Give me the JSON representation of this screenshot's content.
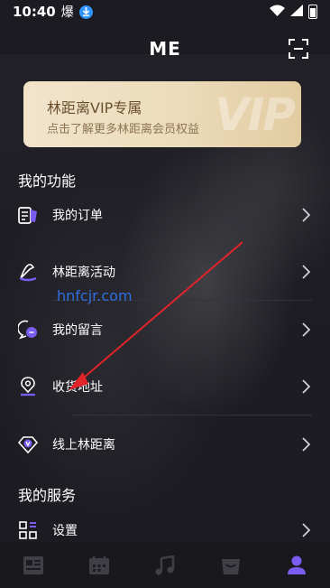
{
  "status_bar": {
    "time": "10:40",
    "boom_glyph": "爆"
  },
  "header": {
    "title": "ME"
  },
  "vip": {
    "title": "林距离VIP专属",
    "subtitle": "点击了解更多林距离会员权益",
    "watermark": "VIP"
  },
  "sections": {
    "functions_title": "我的功能",
    "services_title": "我的服务"
  },
  "menu": [
    {
      "label": "我的订单",
      "icon": "order-icon"
    },
    {
      "label": "林距离活动",
      "icon": "wizard-hat-icon"
    },
    {
      "label": "我的留言",
      "icon": "message-icon"
    },
    {
      "label": "收货地址",
      "icon": "location-icon"
    },
    {
      "label": "线上林距离",
      "icon": "diamond-v-icon"
    },
    {
      "label": "设置",
      "icon": "settings-grid-icon"
    }
  ],
  "watermark_link": "hnfcjr.com",
  "tabs": [
    {
      "name": "news-tab",
      "icon": "newspaper-icon",
      "active": false
    },
    {
      "name": "calendar-tab",
      "icon": "calendar-icon",
      "active": false
    },
    {
      "name": "music-tab",
      "icon": "music-note-icon",
      "active": false
    },
    {
      "name": "shop-tab",
      "icon": "shopping-bag-icon",
      "active": false
    },
    {
      "name": "profile-tab",
      "icon": "person-icon",
      "active": true
    }
  ],
  "colors": {
    "accent": "#7a5cf0",
    "background": "#1b1b21",
    "vip_gold": "#ecdcbc",
    "annotation_arrow": "#e0242a"
  }
}
